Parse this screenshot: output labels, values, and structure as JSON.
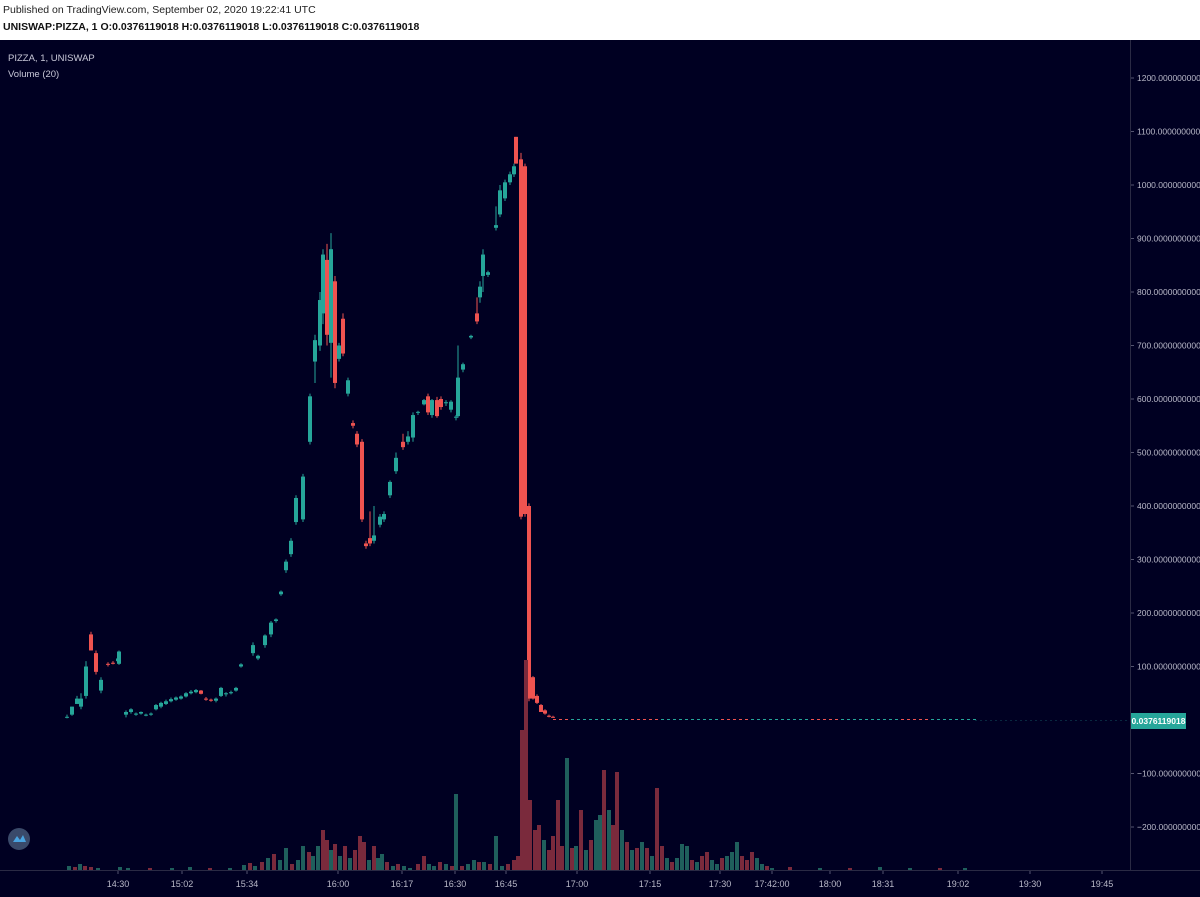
{
  "header": {
    "published": "Published on TradingView.com, September 02, 2020 19:22:41 UTC",
    "symbol": "UNISWAP:PIZZA, 1",
    "o_label": "O:",
    "o_value": "0.0376119018",
    "h_label": "H:",
    "h_value": "0.0376119018",
    "l_label": "L:",
    "l_value": "0.0376119018",
    "c_label": "C:",
    "c_value": "0.0376119018"
  },
  "legend": {
    "title": "PIZZA, 1, UNISWAP",
    "volume": "Volume (20)"
  },
  "current_price_label": "0.0376119018",
  "icons": {
    "logo": "tradingview-logo-icon"
  },
  "colors": {
    "background": "#000022",
    "up": "#26a69a",
    "down": "#ef5350",
    "up_volume": "#1f5f5c",
    "down_volume": "#7a2a3c"
  },
  "chart_data": {
    "type": "candlestick",
    "y_tick_labels": [
      "1200.0000000000",
      "1100.0000000000",
      "1000.0000000000",
      "900.0000000000",
      "800.0000000000",
      "700.0000000000",
      "600.0000000000",
      "500.0000000000",
      "400.0000000000",
      "300.0000000000",
      "200.0000000000",
      "100.0000000000",
      "−100.0000000000",
      "−200.0000000000"
    ],
    "y_ticks": [
      1200,
      1100,
      1000,
      900,
      800,
      700,
      600,
      500,
      400,
      300,
      200,
      100,
      -100,
      -200
    ],
    "ylim": [
      -270,
      1280
    ],
    "x_tick_labels": [
      "14:30",
      "15:02",
      "15:34",
      "16:00",
      "16:17",
      "16:30",
      "16:45",
      "17:00",
      "17:15",
      "17:30",
      "17:42:00",
      "18:00",
      "18:31",
      "19:02",
      "19:30",
      "19:45"
    ],
    "candles": [
      {
        "o": 5,
        "h": 10,
        "l": 3,
        "c": 6
      },
      {
        "o": 10,
        "h": 25,
        "l": 8,
        "c": 25
      },
      {
        "o": 30,
        "h": 45,
        "l": 30,
        "c": 40
      },
      {
        "o": 25,
        "h": 50,
        "l": 20,
        "c": 40
      },
      {
        "o": 45,
        "h": 110,
        "l": 40,
        "c": 100
      },
      {
        "o": 160,
        "h": 165,
        "l": 130,
        "c": 130
      },
      {
        "o": 125,
        "h": 130,
        "l": 85,
        "c": 90
      },
      {
        "o": 55,
        "h": 80,
        "l": 50,
        "c": 75
      },
      {
        "o": 105,
        "h": 108,
        "l": 100,
        "c": 104
      },
      {
        "o": 107,
        "h": 110,
        "l": 104,
        "c": 106
      },
      {
        "o": 110,
        "h": 120,
        "l": 108,
        "c": 115
      },
      {
        "o": 105,
        "h": 130,
        "l": 103,
        "c": 128
      },
      {
        "o": 10,
        "h": 18,
        "l": 5,
        "c": 15
      },
      {
        "o": 15,
        "h": 22,
        "l": 12,
        "c": 20
      },
      {
        "o": 10,
        "h": 14,
        "l": 8,
        "c": 12
      },
      {
        "o": 12,
        "h": 16,
        "l": 10,
        "c": 15
      },
      {
        "o": 9,
        "h": 12,
        "l": 7,
        "c": 10
      },
      {
        "o": 10,
        "h": 14,
        "l": 8,
        "c": 12
      },
      {
        "o": 20,
        "h": 30,
        "l": 18,
        "c": 28
      },
      {
        "o": 25,
        "h": 34,
        "l": 22,
        "c": 32
      },
      {
        "o": 30,
        "h": 38,
        "l": 28,
        "c": 35
      },
      {
        "o": 35,
        "h": 42,
        "l": 33,
        "c": 39
      },
      {
        "o": 38,
        "h": 44,
        "l": 36,
        "c": 42
      },
      {
        "o": 40,
        "h": 46,
        "l": 38,
        "c": 44
      },
      {
        "o": 44,
        "h": 52,
        "l": 42,
        "c": 50
      },
      {
        "o": 50,
        "h": 56,
        "l": 48,
        "c": 53
      },
      {
        "o": 52,
        "h": 58,
        "l": 50,
        "c": 56
      },
      {
        "o": 55,
        "h": 56,
        "l": 48,
        "c": 49
      },
      {
        "o": 40,
        "h": 43,
        "l": 36,
        "c": 38
      },
      {
        "o": 38,
        "h": 40,
        "l": 34,
        "c": 36
      },
      {
        "o": 36,
        "h": 42,
        "l": 33,
        "c": 40
      },
      {
        "o": 45,
        "h": 62,
        "l": 43,
        "c": 60
      },
      {
        "o": 48,
        "h": 52,
        "l": 44,
        "c": 50
      },
      {
        "o": 50,
        "h": 55,
        "l": 48,
        "c": 52
      },
      {
        "o": 55,
        "h": 62,
        "l": 53,
        "c": 60
      },
      {
        "o": 100,
        "h": 106,
        "l": 98,
        "c": 104
      },
      {
        "o": 125,
        "h": 145,
        "l": 120,
        "c": 140
      },
      {
        "o": 115,
        "h": 122,
        "l": 112,
        "c": 120
      },
      {
        "o": 140,
        "h": 160,
        "l": 135,
        "c": 158
      },
      {
        "o": 160,
        "h": 185,
        "l": 155,
        "c": 182
      },
      {
        "o": 185,
        "h": 190,
        "l": 182,
        "c": 188
      },
      {
        "o": 235,
        "h": 242,
        "l": 232,
        "c": 240
      },
      {
        "o": 280,
        "h": 300,
        "l": 275,
        "c": 296
      },
      {
        "o": 310,
        "h": 340,
        "l": 305,
        "c": 335
      },
      {
        "o": 370,
        "h": 420,
        "l": 365,
        "c": 415
      },
      {
        "o": 375,
        "h": 460,
        "l": 370,
        "c": 455
      },
      {
        "o": 520,
        "h": 610,
        "l": 515,
        "c": 605
      },
      {
        "o": 670,
        "h": 720,
        "l": 630,
        "c": 710
      },
      {
        "o": 700,
        "h": 800,
        "l": 690,
        "c": 785
      },
      {
        "o": 760,
        "h": 880,
        "l": 740,
        "c": 870
      },
      {
        "o": 860,
        "h": 890,
        "l": 700,
        "c": 720
      },
      {
        "o": 705,
        "h": 910,
        "l": 640,
        "c": 880
      },
      {
        "o": 820,
        "h": 830,
        "l": 620,
        "c": 630
      },
      {
        "o": 675,
        "h": 705,
        "l": 670,
        "c": 700
      },
      {
        "o": 750,
        "h": 760,
        "l": 680,
        "c": 685
      },
      {
        "o": 610,
        "h": 640,
        "l": 605,
        "c": 635
      },
      {
        "o": 555,
        "h": 560,
        "l": 545,
        "c": 550
      },
      {
        "o": 535,
        "h": 540,
        "l": 510,
        "c": 515
      },
      {
        "o": 520,
        "h": 525,
        "l": 370,
        "c": 375
      },
      {
        "o": 330,
        "h": 335,
        "l": 320,
        "c": 325
      },
      {
        "o": 340,
        "h": 390,
        "l": 325,
        "c": 330
      },
      {
        "o": 335,
        "h": 400,
        "l": 330,
        "c": 345
      },
      {
        "o": 365,
        "h": 385,
        "l": 360,
        "c": 380
      },
      {
        "o": 375,
        "h": 390,
        "l": 370,
        "c": 385
      },
      {
        "o": 420,
        "h": 448,
        "l": 415,
        "c": 445
      },
      {
        "o": 465,
        "h": 500,
        "l": 460,
        "c": 490
      },
      {
        "o": 520,
        "h": 535,
        "l": 505,
        "c": 510
      },
      {
        "o": 520,
        "h": 540,
        "l": 515,
        "c": 530
      },
      {
        "o": 528,
        "h": 575,
        "l": 520,
        "c": 570
      },
      {
        "o": 575,
        "h": 578,
        "l": 570,
        "c": 576
      },
      {
        "o": 590,
        "h": 600,
        "l": 588,
        "c": 598
      },
      {
        "o": 605,
        "h": 610,
        "l": 570,
        "c": 575
      },
      {
        "o": 570,
        "h": 600,
        "l": 565,
        "c": 598
      },
      {
        "o": 598,
        "h": 604,
        "l": 565,
        "c": 568
      },
      {
        "o": 600,
        "h": 605,
        "l": 580,
        "c": 585
      },
      {
        "o": 592,
        "h": 598,
        "l": 587,
        "c": 594
      },
      {
        "o": 580,
        "h": 598,
        "l": 575,
        "c": 595
      },
      {
        "o": 565,
        "h": 570,
        "l": 560,
        "c": 567
      },
      {
        "o": 568,
        "h": 700,
        "l": 565,
        "c": 640
      },
      {
        "o": 655,
        "h": 668,
        "l": 650,
        "c": 665
      },
      {
        "o": 715,
        "h": 720,
        "l": 712,
        "c": 718
      },
      {
        "o": 760,
        "h": 790,
        "l": 740,
        "c": 745
      },
      {
        "o": 790,
        "h": 820,
        "l": 780,
        "c": 810
      },
      {
        "o": 830,
        "h": 880,
        "l": 800,
        "c": 870
      },
      {
        "o": 832,
        "h": 840,
        "l": 828,
        "c": 837
      },
      {
        "o": 920,
        "h": 960,
        "l": 915,
        "c": 925
      },
      {
        "o": 945,
        "h": 1000,
        "l": 940,
        "c": 990
      },
      {
        "o": 975,
        "h": 1010,
        "l": 970,
        "c": 1005
      },
      {
        "o": 1005,
        "h": 1025,
        "l": 1000,
        "c": 1020
      },
      {
        "o": 1020,
        "h": 1040,
        "l": 1015,
        "c": 1035
      },
      {
        "o": 1090,
        "h": 1090,
        "l": 1040,
        "c": 1040
      },
      {
        "o": 1048,
        "h": 1060,
        "l": 375,
        "c": 380
      },
      {
        "o": 1035,
        "h": 1040,
        "l": 380,
        "c": 385
      },
      {
        "o": 400,
        "h": 405,
        "l": 35,
        "c": 40
      },
      {
        "o": 80,
        "h": 82,
        "l": 38,
        "c": 40
      },
      {
        "o": 45,
        "h": 48,
        "l": 30,
        "c": 32
      },
      {
        "o": 28,
        "h": 30,
        "l": 15,
        "c": 15
      },
      {
        "o": 18,
        "h": 20,
        "l": 10,
        "c": 12
      },
      {
        "o": 8,
        "h": 10,
        "l": 5,
        "c": 6
      },
      {
        "o": 6,
        "h": 8,
        "l": 4,
        "c": 5
      }
    ],
    "volumes": []
  }
}
